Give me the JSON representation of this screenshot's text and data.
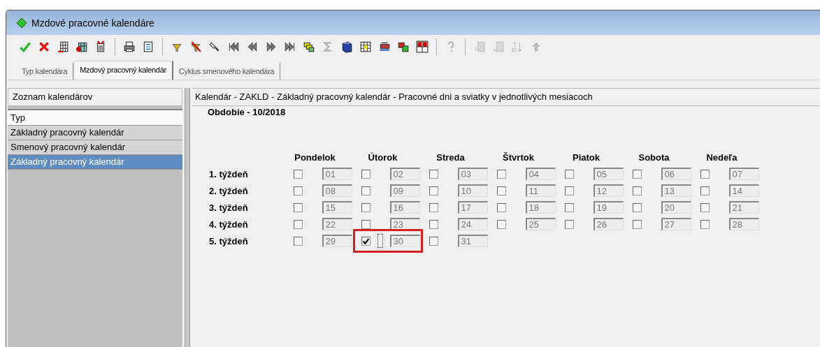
{
  "window": {
    "title": "Mzdové pracovné kalendáre"
  },
  "toolbar": [
    [
      {
        "disabled": false
      },
      {
        "disabled": false
      },
      {
        "disabled": false
      },
      {
        "disabled": false
      },
      {
        "disabled": false
      }
    ],
    [
      {
        "disabled": false
      },
      {
        "disabled": false
      }
    ],
    [
      {
        "disabled": false
      },
      {
        "disabled": false
      },
      {
        "disabled": false
      },
      {
        "disabled": false
      },
      {
        "disabled": false
      },
      {
        "disabled": false
      },
      {
        "disabled": false
      },
      {
        "disabled": false
      },
      {
        "disabled": true
      },
      {
        "disabled": false
      },
      {
        "disabled": false
      },
      {
        "disabled": false
      },
      {
        "disabled": false
      },
      {
        "disabled": false
      }
    ],
    [
      {
        "disabled": true
      }
    ],
    [
      {
        "disabled": true
      },
      {
        "disabled": true
      },
      {
        "disabled": true
      },
      {
        "disabled": true
      }
    ]
  ],
  "tabs": [
    {
      "label": "Typ kalendára",
      "selected": false
    },
    {
      "label": "Mzdový pracovný kalendár",
      "selected": true
    },
    {
      "label": "Cyklus smenového kalendára",
      "selected": false
    }
  ],
  "sidebar": {
    "title": "Zoznam kalendárov",
    "header": "Typ",
    "items": [
      {
        "label": "Základný pracovný kalendár",
        "selected": false
      },
      {
        "label": "Smenový pracovný kalendár",
        "selected": false
      },
      {
        "label": "Základný pracovný kalendár",
        "selected": true
      }
    ]
  },
  "content": {
    "title": "Kalendár - ZAKLD - Základný pracovný kalendár - Pracovné dni a sviatky v jednotlivých mesiacoch",
    "period": "Obdobie - 10/2018",
    "days": [
      "Pondelok",
      "Útorok",
      "Streda",
      "Štvrtok",
      "Piatok",
      "Sobota",
      "Nedeľa"
    ],
    "weeks": [
      {
        "label": "1. týždeň",
        "days": [
          {
            "date": "01",
            "checked": false
          },
          {
            "date": "02",
            "checked": false
          },
          {
            "date": "03",
            "checked": false
          },
          {
            "date": "04",
            "checked": false
          },
          {
            "date": "05",
            "checked": false
          },
          {
            "date": "06",
            "checked": false
          },
          {
            "date": "07",
            "checked": false
          }
        ]
      },
      {
        "label": "2. týždeň",
        "days": [
          {
            "date": "08",
            "checked": false
          },
          {
            "date": "09",
            "checked": false
          },
          {
            "date": "10",
            "checked": false
          },
          {
            "date": "11",
            "checked": false
          },
          {
            "date": "12",
            "checked": false
          },
          {
            "date": "13",
            "checked": false
          },
          {
            "date": "14",
            "checked": false
          }
        ]
      },
      {
        "label": "3. týždeň",
        "days": [
          {
            "date": "15",
            "checked": false
          },
          {
            "date": "16",
            "checked": false
          },
          {
            "date": "17",
            "checked": false
          },
          {
            "date": "18",
            "checked": false
          },
          {
            "date": "19",
            "checked": false
          },
          {
            "date": "20",
            "checked": false
          },
          {
            "date": "21",
            "checked": false
          }
        ]
      },
      {
        "label": "4. týždeň",
        "days": [
          {
            "date": "22",
            "checked": false
          },
          {
            "date": "23",
            "checked": false
          },
          {
            "date": "24",
            "checked": false
          },
          {
            "date": "25",
            "checked": false
          },
          {
            "date": "26",
            "checked": false
          },
          {
            "date": "27",
            "checked": false
          },
          {
            "date": "28",
            "checked": false
          }
        ]
      },
      {
        "label": "5. týždeň",
        "days": [
          {
            "date": "29",
            "checked": false
          },
          {
            "date": "30",
            "checked": true,
            "focused": true,
            "highlighted": true
          },
          {
            "date": "31",
            "checked": false
          }
        ]
      }
    ]
  }
}
